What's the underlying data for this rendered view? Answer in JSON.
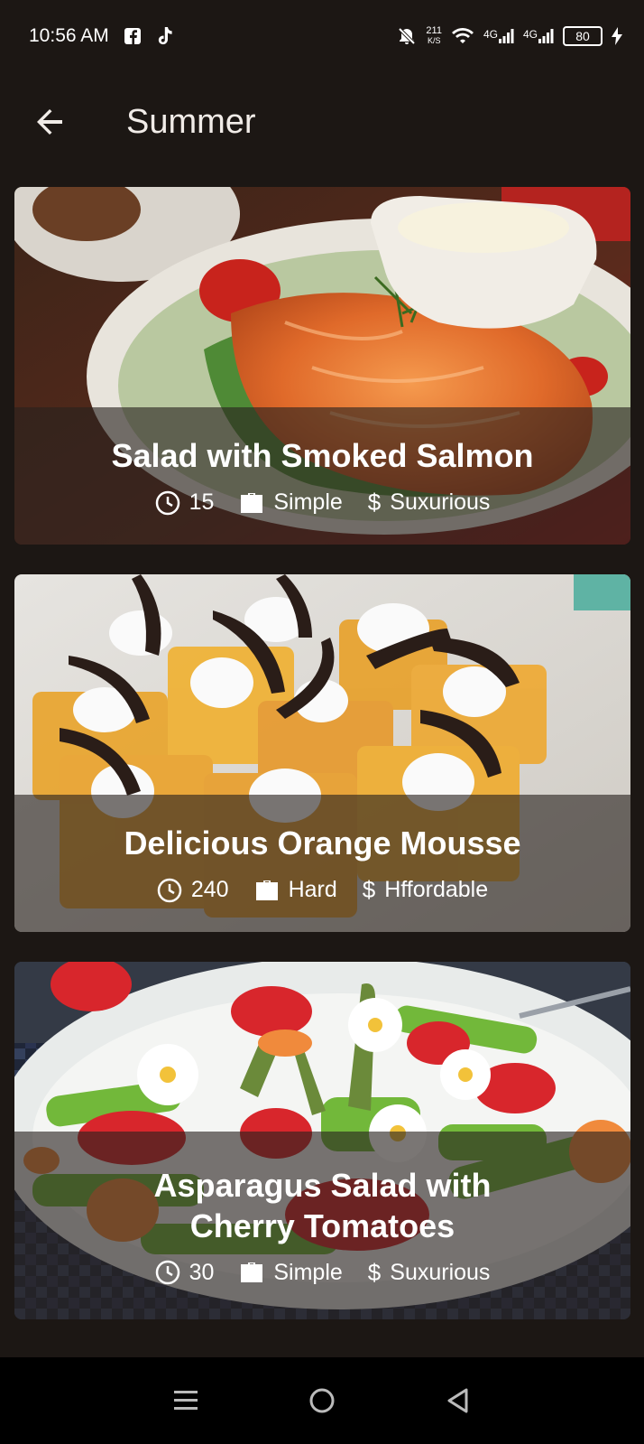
{
  "status_bar": {
    "time": "10:56 AM",
    "net_speed_value": "211",
    "net_speed_unit": "K/S",
    "signal_1_label": "4G",
    "signal_2_label": "4G",
    "battery": "80",
    "icons": [
      "facebook-icon",
      "tiktok-icon",
      "mute-icon",
      "wifi-icon",
      "signal-icon",
      "battery-icon",
      "charging-icon"
    ]
  },
  "app_bar": {
    "title": "Summer",
    "back_icon": "arrow-left-icon"
  },
  "meals": [
    {
      "title": "Salad with Smoked Salmon",
      "duration": "15",
      "complexity": "Simple",
      "affordability": "Suxurious",
      "image": "smoked-salmon-salad-photo"
    },
    {
      "title": "Delicious Orange Mousse",
      "duration": "240",
      "complexity": "Hard",
      "affordability": "Hffordable",
      "image": "orange-mousse-photo"
    },
    {
      "title": "Asparagus Salad with Cherry Tomatoes",
      "duration": "30",
      "complexity": "Simple",
      "affordability": "Suxurious",
      "image": "asparagus-salad-photo"
    }
  ],
  "colors": {
    "background": "#1c1714",
    "overlay": "#28221e",
    "text": "#ffffff",
    "nav_bar": "#000000"
  },
  "nav_bar": {
    "items": [
      "menu-icon",
      "home-icon",
      "back-triangle-icon"
    ]
  }
}
